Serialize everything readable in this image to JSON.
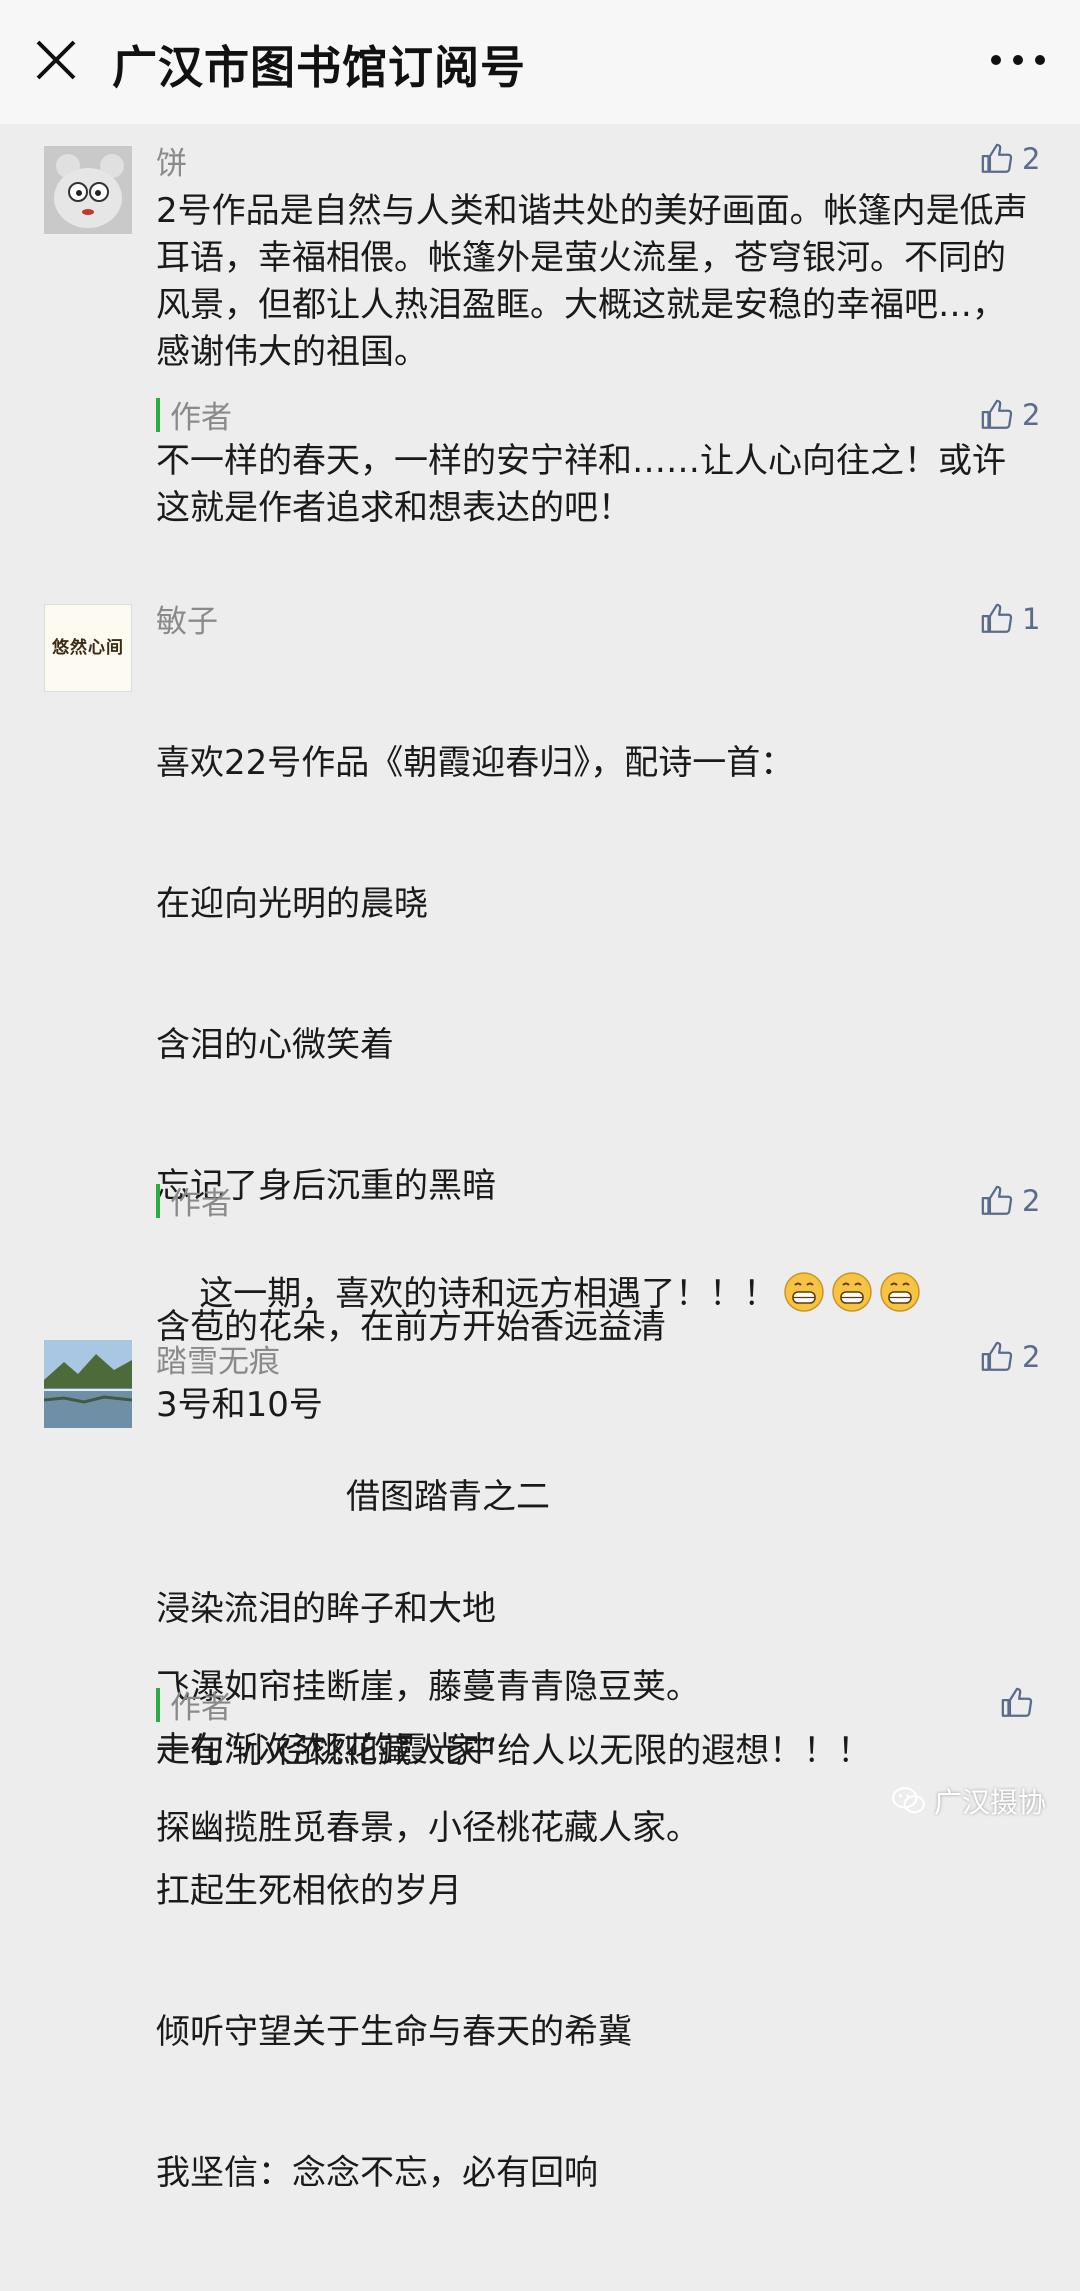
{
  "header": {
    "title": "广汉市图书馆订阅号"
  },
  "comments": [
    {
      "nickname": "饼",
      "likes": "2",
      "text": "2号作品是自然与人类和谐共处的美好画面。帐篷内是低声耳语，幸福相偎。帐篷外是萤火流星，苍穹银河。不同的风景，但都让人热泪盈眶。大概这就是安稳的幸福吧…，感谢伟大的祖国。",
      "reply": {
        "tag": "作者",
        "likes": "2",
        "text": "不一样的春天，一样的安宁祥和……让人心向往之！或许这就是作者追求和想表达的吧！"
      }
    },
    {
      "nickname": "敏子",
      "likes": "1",
      "avatar_text": "悠然心间",
      "lines": [
        "喜欢22号作品《朝霞迎春归》，配诗一首：",
        "在迎向光明的晨晓",
        "含泪的心微笑着",
        "忘记了身后沉重的黑暗",
        "含苞的花朵，在前方开始香远益清",
        "",
        "浸染流泪的眸子和大地",
        "走在渐次浓烈的霞光中",
        "扛起生死相依的岁月",
        "倾听守望关于生命与春天的希冀",
        "我坚信：念念不忘，必有回响"
      ],
      "reply": {
        "tag": "作者",
        "likes": "2",
        "text": "这一期，喜欢的诗和远方相遇了！！！"
      }
    },
    {
      "nickname": "踏雪无痕",
      "likes": "2",
      "text": "3号和10号",
      "poem_title": "借图踏青之二",
      "poem_lines": [
        "飞瀑如帘挂断崖，藤蔓青青隐豆荚。",
        "探幽揽胜觅春景，小径桃花藏人家。"
      ],
      "reply": {
        "tag": "作者",
        "text": "一句“小径桃花藏人家”给人以无限的遐想！！！"
      }
    }
  ],
  "watermark": "广汉摄协"
}
